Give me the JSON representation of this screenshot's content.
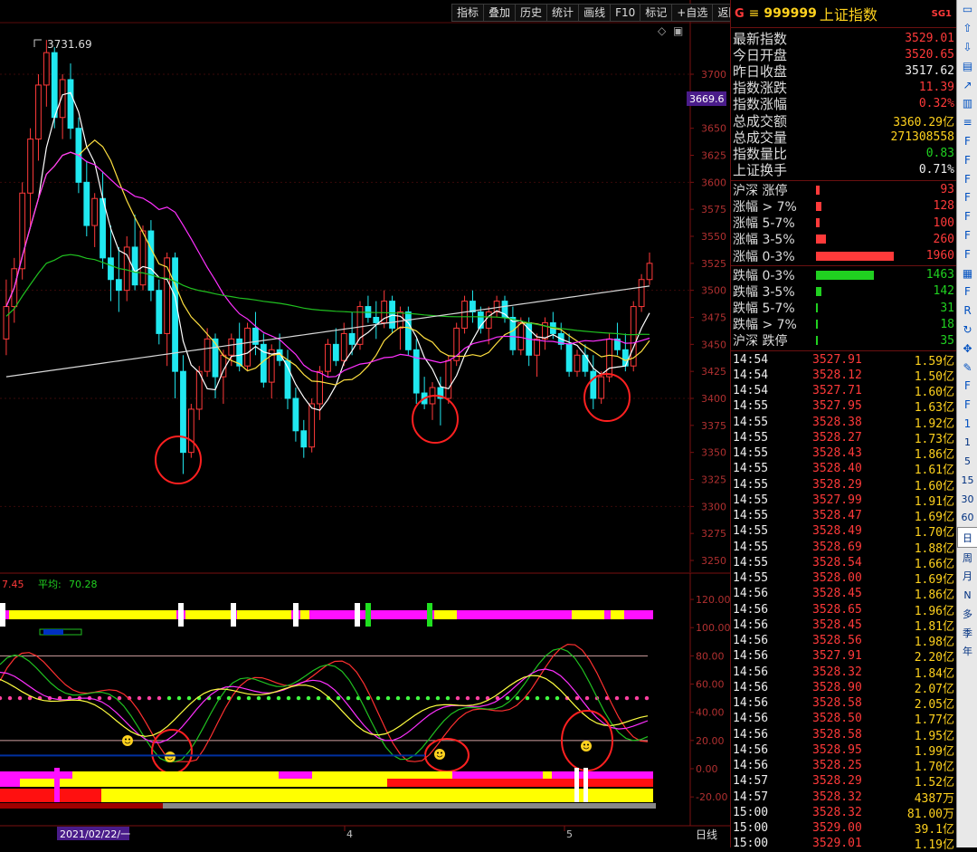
{
  "toolbar": {
    "buttons": [
      "指标",
      "叠加",
      "历史",
      "统计",
      "画线",
      "F10",
      "标记",
      "+自选",
      "返回"
    ]
  },
  "price_chart": {
    "high_marker": "3731.69",
    "current_price_tag": "3669.6",
    "y_axis_ticks": [
      "3700",
      "3675",
      "3650",
      "3625",
      "3600",
      "3575",
      "3550",
      "3525",
      "3500",
      "3475",
      "3450",
      "3425",
      "3400",
      "3375",
      "3350",
      "3325",
      "3300",
      "3275",
      "3250"
    ],
    "corner_icons": [
      "diamond-icon",
      "window-icon"
    ]
  },
  "indicator_panel": {
    "header_value": "7.45",
    "header_avg_label": "平均:",
    "header_avg_value": "70.28",
    "y_axis_ticks": [
      "120.00",
      "100.00",
      "80.00",
      "60.00",
      "40.00",
      "20.00",
      "0.00",
      "-20.00"
    ]
  },
  "time_axis": {
    "labels": [
      {
        "text": "2021/02/22/一",
        "highlight": true
      },
      {
        "text": "4",
        "highlight": false
      },
      {
        "text": "5",
        "highlight": false
      }
    ],
    "period_label": "日线"
  },
  "quote": {
    "title_prefix": "G",
    "title_menu": "≡",
    "code": "999999",
    "name": "上证指数",
    "tag": "SG1",
    "stats": [
      {
        "label": "最新指数",
        "value": "3529.01",
        "color": "red"
      },
      {
        "label": "今日开盘",
        "value": "3520.65",
        "color": "red"
      },
      {
        "label": "昨日收盘",
        "value": "3517.62",
        "color": "white"
      },
      {
        "label": "指数涨跌",
        "value": "11.39",
        "color": "red"
      },
      {
        "label": "指数涨幅",
        "value": "0.32%",
        "color": "red"
      },
      {
        "label": "总成交额",
        "value": "3360.29亿",
        "color": "yellow"
      },
      {
        "label": "总成交量",
        "value": "271308558",
        "color": "yellow"
      },
      {
        "label": "指数量比",
        "value": "0.83",
        "color": "green"
      },
      {
        "label": "上证换手",
        "value": "0.71%",
        "color": "white"
      }
    ],
    "breadth_up": [
      {
        "label": "沪深 涨停",
        "value": "93",
        "bar": 0.047
      },
      {
        "label": "涨幅 > 7%",
        "value": "128",
        "bar": 0.065
      },
      {
        "label": "涨幅 5-7%",
        "value": "100",
        "bar": 0.051
      },
      {
        "label": "涨幅 3-5%",
        "value": "260",
        "bar": 0.133
      },
      {
        "label": "涨幅 0-3%",
        "value": "1960",
        "bar": 1.0
      }
    ],
    "breadth_down": [
      {
        "label": "跌幅 0-3%",
        "value": "1463",
        "bar": 0.746
      },
      {
        "label": "跌幅 3-5%",
        "value": "142",
        "bar": 0.072
      },
      {
        "label": "跌幅 5-7%",
        "value": "31",
        "bar": 0.016
      },
      {
        "label": "跌幅 > 7%",
        "value": "18",
        "bar": 0.009
      },
      {
        "label": "沪深 跌停",
        "value": "35",
        "bar": 0.018
      }
    ],
    "colors": {
      "up": "#ff3a3a",
      "down": "#20d020"
    }
  },
  "ticks": [
    {
      "time": "14:54",
      "price": "3527.91",
      "vol": "1.59亿"
    },
    {
      "time": "14:54",
      "price": "3528.12",
      "vol": "1.50亿"
    },
    {
      "time": "14:54",
      "price": "3527.71",
      "vol": "1.60亿"
    },
    {
      "time": "14:55",
      "price": "3527.95",
      "vol": "1.63亿"
    },
    {
      "time": "14:55",
      "price": "3528.38",
      "vol": "1.92亿"
    },
    {
      "time": "14:55",
      "price": "3528.27",
      "vol": "1.73亿"
    },
    {
      "time": "14:55",
      "price": "3528.43",
      "vol": "1.86亿"
    },
    {
      "time": "14:55",
      "price": "3528.40",
      "vol": "1.61亿"
    },
    {
      "time": "14:55",
      "price": "3528.29",
      "vol": "1.60亿"
    },
    {
      "time": "14:55",
      "price": "3527.99",
      "vol": "1.91亿"
    },
    {
      "time": "14:55",
      "price": "3528.47",
      "vol": "1.69亿"
    },
    {
      "time": "14:55",
      "price": "3528.49",
      "vol": "1.70亿"
    },
    {
      "time": "14:55",
      "price": "3528.69",
      "vol": "1.88亿"
    },
    {
      "time": "14:55",
      "price": "3528.54",
      "vol": "1.66亿"
    },
    {
      "time": "14:55",
      "price": "3528.00",
      "vol": "1.69亿"
    },
    {
      "time": "14:56",
      "price": "3528.45",
      "vol": "1.86亿"
    },
    {
      "time": "14:56",
      "price": "3528.65",
      "vol": "1.96亿"
    },
    {
      "time": "14:56",
      "price": "3528.45",
      "vol": "1.81亿"
    },
    {
      "time": "14:56",
      "price": "3528.56",
      "vol": "1.98亿"
    },
    {
      "time": "14:56",
      "price": "3527.91",
      "vol": "2.20亿"
    },
    {
      "time": "14:56",
      "price": "3528.32",
      "vol": "1.84亿"
    },
    {
      "time": "14:56",
      "price": "3528.90",
      "vol": "2.07亿"
    },
    {
      "time": "14:56",
      "price": "3528.58",
      "vol": "2.05亿"
    },
    {
      "time": "14:56",
      "price": "3528.50",
      "vol": "1.77亿"
    },
    {
      "time": "14:56",
      "price": "3528.58",
      "vol": "1.95亿"
    },
    {
      "time": "14:56",
      "price": "3528.95",
      "vol": "1.99亿"
    },
    {
      "time": "14:56",
      "price": "3528.25",
      "vol": "1.70亿"
    },
    {
      "time": "14:57",
      "price": "3528.29",
      "vol": "1.52亿"
    },
    {
      "time": "14:57",
      "price": "3528.32",
      "vol": "4387万"
    },
    {
      "time": "15:00",
      "price": "3528.32",
      "vol": "81.00万"
    },
    {
      "time": "15:00",
      "price": "3529.00",
      "vol": "39.1亿"
    },
    {
      "time": "15:00",
      "price": "3529.01",
      "vol": "1.19亿"
    }
  ],
  "side_tools": [
    {
      "name": "window-icon",
      "kind": "icon"
    },
    {
      "name": "up-arrow-icon",
      "kind": "icon"
    },
    {
      "name": "down-arrow-icon",
      "kind": "icon"
    },
    {
      "name": "kline-icon",
      "kind": "icon"
    },
    {
      "name": "trend-icon",
      "kind": "icon"
    },
    {
      "name": "bar-icon",
      "kind": "icon"
    },
    {
      "name": "list-icon",
      "kind": "icon"
    },
    {
      "name": "f10-icon",
      "kind": "icon"
    },
    {
      "name": "f-icon",
      "kind": "icon"
    },
    {
      "name": "f-icon",
      "kind": "icon"
    },
    {
      "name": "f-icon",
      "kind": "icon"
    },
    {
      "name": "f-icon",
      "kind": "icon"
    },
    {
      "name": "f-icon",
      "kind": "icon"
    },
    {
      "name": "f-icon",
      "kind": "icon"
    },
    {
      "name": "grid-icon",
      "kind": "icon"
    },
    {
      "name": "f-icon",
      "kind": "icon"
    },
    {
      "name": "rsi-icon",
      "kind": "icon"
    },
    {
      "name": "refresh-icon",
      "kind": "icon"
    },
    {
      "name": "move-icon",
      "kind": "icon"
    },
    {
      "name": "pen-icon",
      "kind": "icon"
    },
    {
      "name": "f-icon",
      "kind": "icon"
    },
    {
      "name": "f-icon",
      "kind": "icon"
    },
    {
      "name": "one-icon",
      "kind": "icon"
    }
  ],
  "periods": [
    "1",
    "5",
    "15",
    "30",
    "60",
    "日",
    "周",
    "月",
    "N",
    "多",
    "季",
    "年"
  ],
  "selected_period": "日"
}
